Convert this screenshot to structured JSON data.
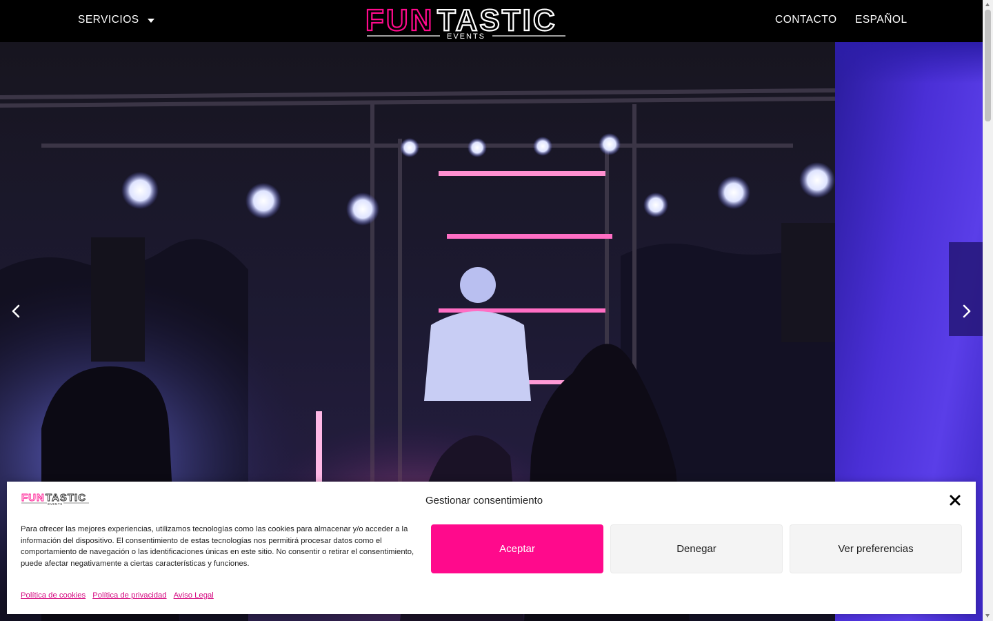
{
  "header": {
    "menu_services": "SERVICIOS",
    "menu_contact": "CONTACTO",
    "menu_language": "ESPAÑOL",
    "logo": {
      "part1": "FUN",
      "part2": "TASTIC",
      "sub": "EVENTS"
    }
  },
  "colors": {
    "brand_pink": "#ff0a8c",
    "link_pink": "#d4087f",
    "header_bg": "#000000"
  },
  "slider": {
    "prev_icon": "chevron-left-icon",
    "next_icon": "chevron-right-icon"
  },
  "cookie": {
    "title": "Gestionar consentimiento",
    "body": "Para ofrecer las mejores experiencias, utilizamos tecnologías como las cookies para almacenar y/o acceder a la información del dispositivo. El consentimiento de estas tecnologías nos permitirá procesar datos como el comportamiento de navegación o las identificaciones únicas en este sitio. No consentir o retirar el consentimiento, puede afectar negativamente a ciertas características y funciones.",
    "accept": "Aceptar",
    "deny": "Denegar",
    "preferences": "Ver preferencias",
    "links": [
      "Política de cookies",
      "Política de privacidad",
      "Aviso Legal"
    ],
    "logo": {
      "part1": "FUN",
      "part2": "TASTIC",
      "sub": "EVENTS"
    }
  }
}
